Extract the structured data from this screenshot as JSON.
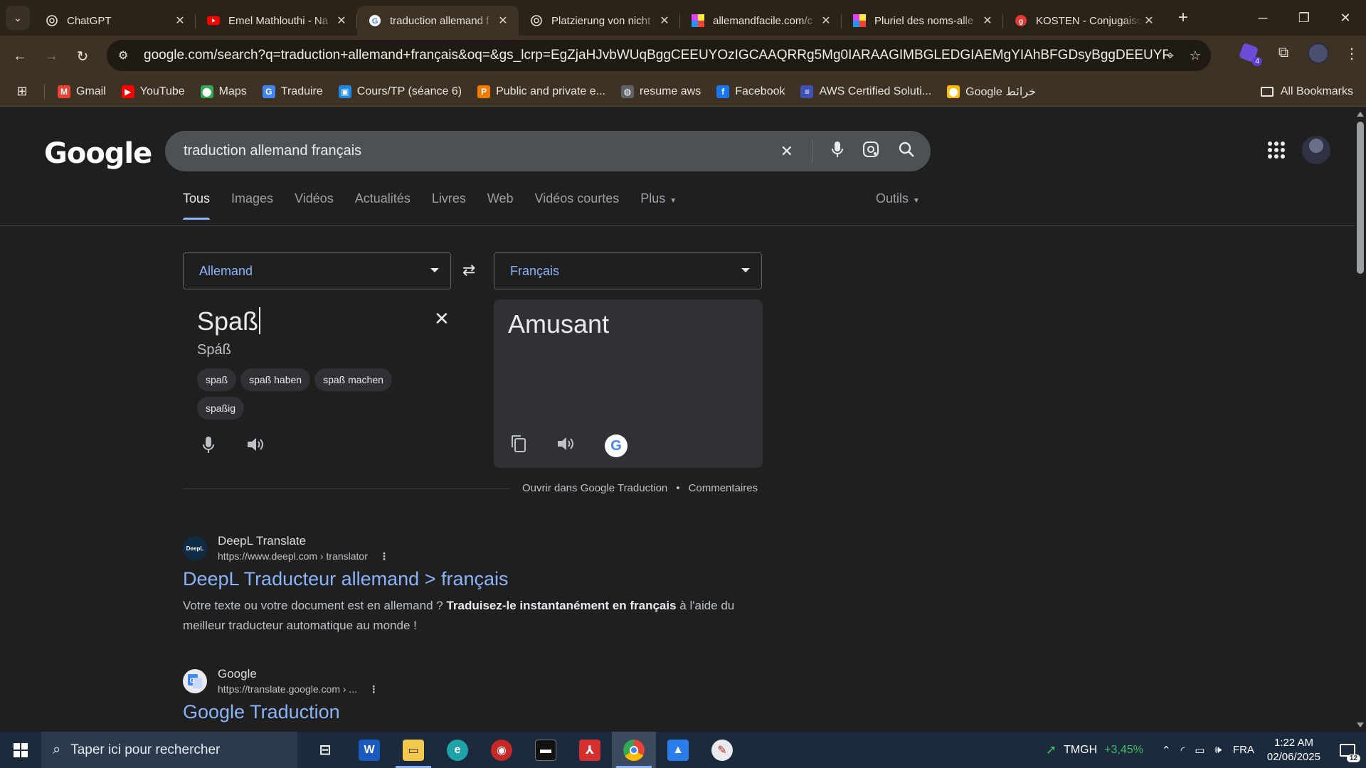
{
  "browser": {
    "tabs": [
      {
        "title": "ChatGPT",
        "icon": "chatgpt-icon",
        "color": "#e8e3dc"
      },
      {
        "title": "Emel Mathlouthi - Na",
        "icon": "youtube-icon",
        "color": "#ff0000"
      },
      {
        "title": "traduction allemand f",
        "icon": "google-icon",
        "color": "#4285f4"
      },
      {
        "title": "Platzierung von nicht",
        "icon": "chatgpt-icon",
        "color": "#e8e3dc"
      },
      {
        "title": "allemandfacile.com/c",
        "icon": "colorblocks-icon",
        "color": "#e040fb"
      },
      {
        "title": "Pluriel des noms-alle",
        "icon": "colorblocks-icon",
        "color": "#e040fb"
      },
      {
        "title": "KOSTEN - Conjugaisc",
        "icon": "red-circle-icon",
        "color": "#e53935"
      }
    ],
    "url": "google.com/search?q=traduction+allemand+français&oq=&gs_lcrp=EgZjaHJvbWUqBggCEEUYOzIGCAAQRRg5Mg0IARAAGIMBGLEDGIAEMgYIAhBFGDsyBggDEEUYPDIGCAQQRRg8...",
    "extension_badge": "4",
    "bookmarks": [
      {
        "label": "Gmail",
        "icon": "gmail-icon",
        "color": "#ea4335",
        "glyph": "M"
      },
      {
        "label": "YouTube",
        "icon": "youtube-icon",
        "color": "#ff0000",
        "glyph": "▶"
      },
      {
        "label": "Maps",
        "icon": "maps-icon",
        "color": "#34a853",
        "glyph": "⬤"
      },
      {
        "label": "Traduire",
        "icon": "translate-icon",
        "color": "#4285f4",
        "glyph": "G"
      },
      {
        "label": "Cours/TP (séance 6)",
        "icon": "classroom-icon",
        "color": "#1e88e5",
        "glyph": "▣"
      },
      {
        "label": "Public and private e...",
        "icon": "p-icon",
        "color": "#f57c00",
        "glyph": "P"
      },
      {
        "label": "resume aws",
        "icon": "globe-icon",
        "color": "#5f6368",
        "glyph": "◍"
      },
      {
        "label": "Facebook",
        "icon": "facebook-icon",
        "color": "#1877f2",
        "glyph": "f"
      },
      {
        "label": "AWS Certified Soluti...",
        "icon": "aws-icon",
        "color": "#3f51b5",
        "glyph": "≡"
      },
      {
        "label": "Google خرائط",
        "icon": "maps-icon",
        "color": "#fbbc04",
        "glyph": "⬤"
      }
    ],
    "all_bookmarks": "All Bookmarks"
  },
  "google": {
    "logo": "Google",
    "query": "traduction allemand français",
    "tabs": [
      "Tous",
      "Images",
      "Vidéos",
      "Actualités",
      "Livres",
      "Web",
      "Vidéos courtes",
      "Plus"
    ],
    "tools": "Outils"
  },
  "translator": {
    "source_lang": "Allemand",
    "target_lang": "Français",
    "source_text": "Spaß",
    "transliteration": "Spáß",
    "suggestions": [
      "spaß",
      "spaß haben",
      "spaß machen",
      "spaßig"
    ],
    "translation": "Amusant",
    "open_link": "Ouvrir dans Google Traduction",
    "feedback": "Commentaires"
  },
  "results": [
    {
      "site": "DeepL Translate",
      "url": "https://www.deepl.com › translator",
      "title": "DeepL Traducteur allemand > français",
      "snippet_a": "Votre texte ou votre document est en allemand ? ",
      "snippet_b": "Traduisez-le instantanément en français",
      "snippet_c": " à l'aide du meilleur traducteur automatique au monde !"
    },
    {
      "site": "Google",
      "url": "https://translate.google.com › ...",
      "title": "Google Traduction"
    }
  ],
  "taskbar": {
    "search_placeholder": "Taper ici pour rechercher",
    "stock_symbol": "TMGH",
    "stock_change": "+3,45%",
    "language": "FRA",
    "time": "1:22 AM",
    "date": "02/06/2025",
    "notifications": "12"
  }
}
